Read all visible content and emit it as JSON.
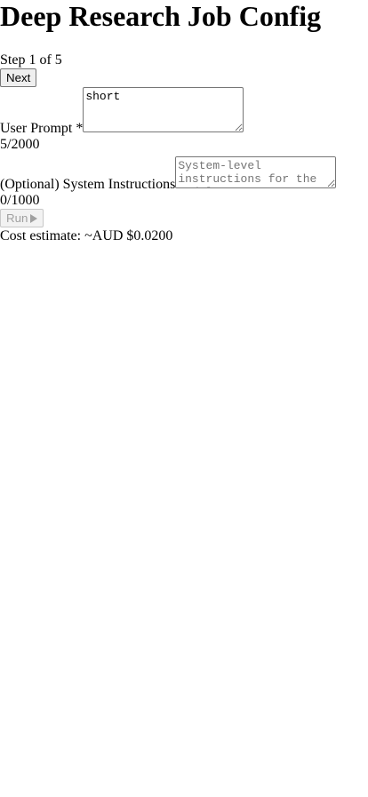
{
  "page": {
    "title": "Deep Research Job Config"
  },
  "wizard": {
    "step_text": "Step 1 of 5",
    "next_label": "Next"
  },
  "user_prompt": {
    "label": "User Prompt *",
    "value": "short",
    "counter": "5/2000"
  },
  "system_instructions": {
    "label": "(Optional) System Instructions",
    "placeholder": "System-level instructions for the model",
    "value": "",
    "counter": "0/1000"
  },
  "run": {
    "label": "Run",
    "icon": "play-icon",
    "disabled": true
  },
  "cost": {
    "text": "Cost estimate: ~AUD $0.0200"
  }
}
